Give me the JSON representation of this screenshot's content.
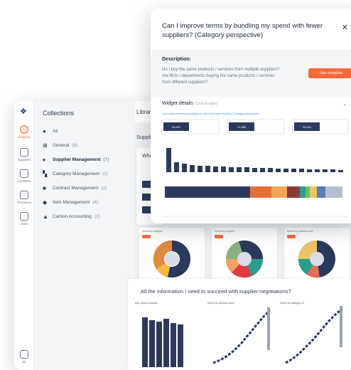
{
  "sidebar": {
    "items": [
      {
        "label": "Analytics",
        "icon": "analytics-icon",
        "active": true
      },
      {
        "label": "Suppliers",
        "icon": "suppliers-icon"
      },
      {
        "label": "Contracts",
        "icon": "contracts-icon"
      },
      {
        "label": "Emissions",
        "icon": "emissions-icon"
      },
      {
        "label": "Data",
        "icon": "data-icon"
      }
    ],
    "bottom_label": "Sp"
  },
  "collections": {
    "title": "Collections",
    "items": [
      {
        "label": "All",
        "count": "",
        "icon": "circle-icon"
      },
      {
        "label": "General",
        "count": "(9)",
        "icon": "grid-icon"
      },
      {
        "label": "Supplier Management",
        "count": "(7)",
        "icon": "handshake-icon",
        "bold": true
      },
      {
        "label": "Category Management",
        "count": "(2)",
        "icon": "category-icon"
      },
      {
        "label": "Contract Management",
        "count": "(2)",
        "icon": "contract-icon"
      },
      {
        "label": "Item Management",
        "count": "(4)",
        "icon": "tag-icon"
      },
      {
        "label": "Carbon Accounting",
        "count": "(2)",
        "icon": "flask-icon"
      }
    ]
  },
  "library": {
    "title": "Library",
    "section": "Supplie",
    "who_label": "Who"
  },
  "bottom": {
    "title": "All the information I need to succeed with supplier negotiations?"
  },
  "modal": {
    "title": "Can I improve terms by bundling my spend with fewer suppliers? (Category perspective)",
    "description_heading": "Description:",
    "description": "Do I buy the same products / services from multiple suppliers? Are BUs / departments buying the same products / services from different suppliers?",
    "use_template": "Use template",
    "widget_details": "Widget details",
    "widget_hint": "(Click to open)",
    "preview_title": "Can I improve terms by bundling my spend with fewer suppliers? (Category perspective)",
    "kpis": [
      "43,601",
      "11,388",
      "29,441"
    ]
  },
  "colors": {
    "accent": "#f26b3a",
    "navy": "#2b3a5c"
  }
}
